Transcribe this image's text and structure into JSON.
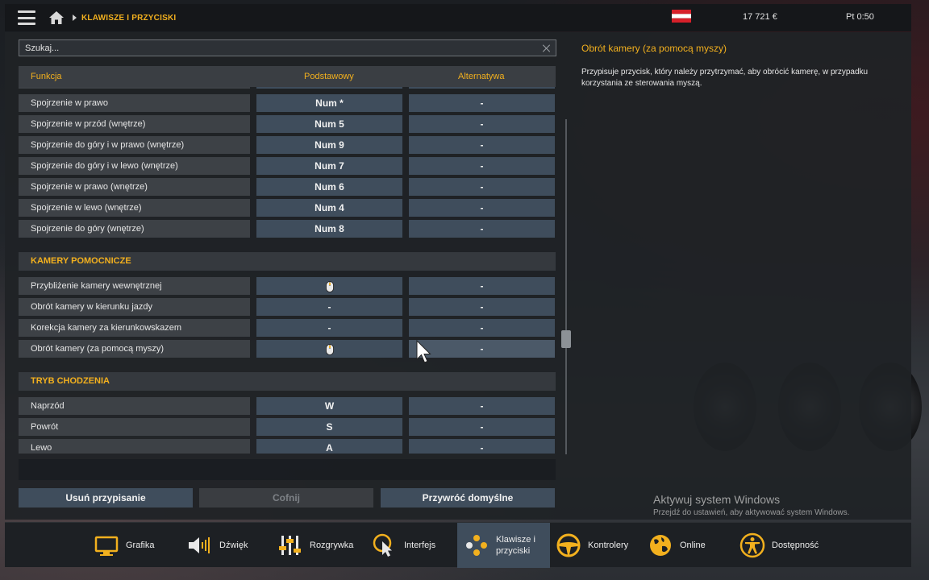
{
  "topbar": {
    "breadcrumb": "KLAWISZE I PRZYCISKI",
    "money": "17 721 €",
    "time": "Pt 0:50"
  },
  "search": {
    "placeholder": "Szukaj..."
  },
  "columns": {
    "function": "Funkcja",
    "primary": "Podstawowy",
    "alternative": "Alternatywa"
  },
  "rows_group1": [
    {
      "label": "Spojrzenie w prawo",
      "primary": "Num *",
      "alt": "-"
    },
    {
      "label": "Spojrzenie w przód (wnętrze)",
      "primary": "Num 5",
      "alt": "-"
    },
    {
      "label": "Spojrzenie do góry i w prawo (wnętrze)",
      "primary": "Num 9",
      "alt": "-"
    },
    {
      "label": "Spojrzenie do góry i w lewo (wnętrze)",
      "primary": "Num 7",
      "alt": "-"
    },
    {
      "label": "Spojrzenie w prawo (wnętrze)",
      "primary": "Num 6",
      "alt": "-"
    },
    {
      "label": "Spojrzenie w lewo (wnętrze)",
      "primary": "Num 4",
      "alt": "-"
    },
    {
      "label": "Spojrzenie do góry (wnętrze)",
      "primary": "Num 8",
      "alt": "-"
    }
  ],
  "section_cameras": "KAMERY POMOCNICZE",
  "rows_group2": [
    {
      "label": "Przybliżenie kamery wewnętrznej",
      "primary": "",
      "primary_icon": "mouse-icon",
      "alt": "-"
    },
    {
      "label": "Obrót kamery w kierunku jazdy",
      "primary": "-",
      "alt": "-"
    },
    {
      "label": "Korekcja kamery za kierunkowskazem",
      "primary": "-",
      "alt": "-"
    },
    {
      "label": "Obrót kamery (za pomocą myszy)",
      "primary": "",
      "primary_icon": "mouse-icon",
      "alt": "-"
    }
  ],
  "section_walking": "TRYB CHODZENIA",
  "rows_group3": [
    {
      "label": "Naprzód",
      "primary": "W",
      "alt": "-"
    },
    {
      "label": "Powrót",
      "primary": "S",
      "alt": "-"
    },
    {
      "label": "Lewo",
      "primary": "A",
      "alt": "-"
    }
  ],
  "buttons": {
    "remove": "Usuń przypisanie",
    "undo": "Cofnij",
    "restore": "Przywróć domyślne"
  },
  "description": {
    "title": "Obrót kamery (za pomocą myszy)",
    "text": "Przypisuje przycisk, który należy przytrzymać, aby obrócić kamerę, w przypadku korzystania ze sterowania myszą."
  },
  "watermark": {
    "title": "Aktywuj system Windows",
    "subtitle": "Przejdź do ustawień, aby aktywować system Windows."
  },
  "tabs": [
    {
      "label": "Grafika",
      "icon": "monitor-icon"
    },
    {
      "label": "Dźwięk",
      "icon": "speaker-icon"
    },
    {
      "label": "Rozgrywka",
      "icon": "sliders-icon"
    },
    {
      "label": "Interfejs",
      "icon": "cursor-icon"
    },
    {
      "label1": "Klawisze i",
      "label2": "przyciski",
      "icon": "gamepad-icon",
      "active": true
    },
    {
      "label": "Kontrolery",
      "icon": "steering-wheel-icon"
    },
    {
      "label": "Online",
      "icon": "globe-icon"
    },
    {
      "label": "Dostępność",
      "icon": "accessibility-icon"
    }
  ],
  "colors": {
    "accent": "#f2b01e",
    "key_bg": "#3f4d5c",
    "row_bg": "#3d4146"
  }
}
